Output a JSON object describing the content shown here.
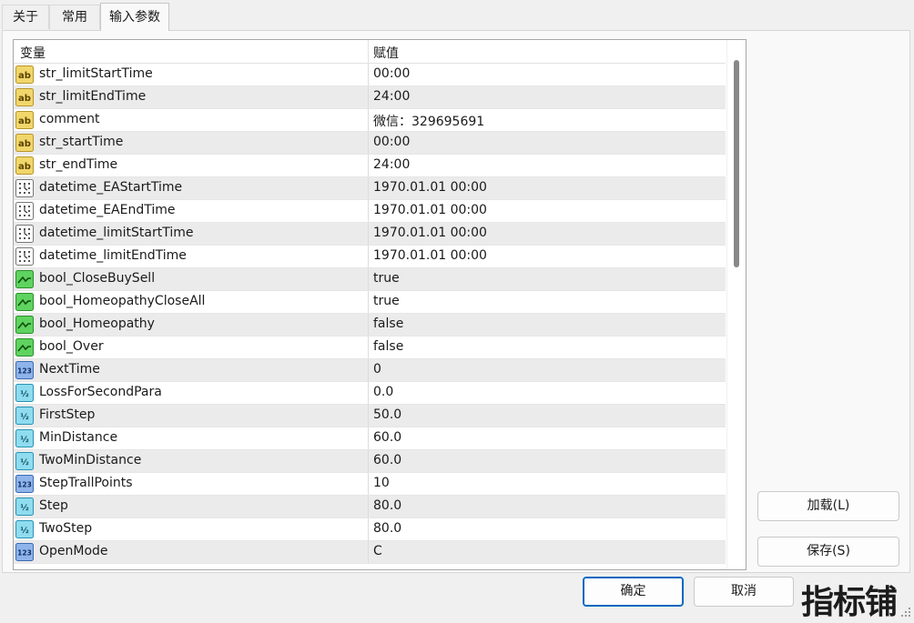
{
  "tabs": [
    {
      "label": "关于"
    },
    {
      "label": "常用"
    },
    {
      "label": "输入参数"
    }
  ],
  "table": {
    "headers": {
      "variable": "变量",
      "value": "赋值"
    },
    "rows": [
      {
        "icon": "ab",
        "name": "str_limitStartTime",
        "value": "00:00"
      },
      {
        "icon": "ab",
        "name": "str_limitEndTime",
        "value": "24:00"
      },
      {
        "icon": "ab",
        "name": "comment",
        "value": "微信：329695691"
      },
      {
        "icon": "ab",
        "name": "str_startTime",
        "value": "00:00"
      },
      {
        "icon": "ab",
        "name": "str_endTime",
        "value": "24:00"
      },
      {
        "icon": "datetime",
        "name": "datetime_EAStartTime",
        "value": "1970.01.01 00:00"
      },
      {
        "icon": "datetime",
        "name": "datetime_EAEndTime",
        "value": "1970.01.01 00:00"
      },
      {
        "icon": "datetime",
        "name": "datetime_limitStartTime",
        "value": "1970.01.01 00:00"
      },
      {
        "icon": "datetime",
        "name": "datetime_limitEndTime",
        "value": "1970.01.01 00:00"
      },
      {
        "icon": "bool",
        "name": "bool_CloseBuySell",
        "value": "true"
      },
      {
        "icon": "bool",
        "name": "bool_HomeopathyCloseAll",
        "value": "true"
      },
      {
        "icon": "bool",
        "name": "bool_Homeopathy",
        "value": "false"
      },
      {
        "icon": "bool",
        "name": "bool_Over",
        "value": "false"
      },
      {
        "icon": "int",
        "name": "NextTime",
        "value": "0"
      },
      {
        "icon": "double",
        "name": "LossForSecondPara",
        "value": "0.0"
      },
      {
        "icon": "double",
        "name": "FirstStep",
        "value": "50.0"
      },
      {
        "icon": "double",
        "name": "MinDistance",
        "value": "60.0"
      },
      {
        "icon": "double",
        "name": "TwoMinDistance",
        "value": "60.0"
      },
      {
        "icon": "int",
        "name": "StepTrallPoints",
        "value": "10"
      },
      {
        "icon": "double",
        "name": "Step",
        "value": "80.0"
      },
      {
        "icon": "double",
        "name": "TwoStep",
        "value": "80.0"
      },
      {
        "icon": "int",
        "name": "OpenMode",
        "value": "C"
      }
    ]
  },
  "buttons": {
    "load": "加载(L)",
    "save": "保存(S)",
    "ok": "确定",
    "cancel": "取消"
  },
  "watermark": "指标铺",
  "colors": {
    "accent": "#0067c0",
    "row_alt": "#ebebeb",
    "string_icon": "#e8c547",
    "bool_icon": "#3fbf3f",
    "int_icon": "#4a7fc8",
    "double_icon": "#39a8c8"
  }
}
